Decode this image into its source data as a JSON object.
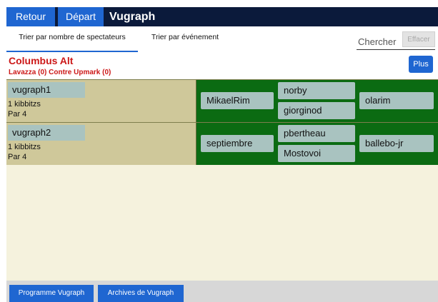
{
  "topbar": {
    "retour_label": "Retour",
    "depart_label": "Départ",
    "title": "Vugraph"
  },
  "tabs": [
    {
      "label": "Trier par nombre de spectateurs",
      "active": true
    },
    {
      "label": "Trier par événement",
      "active": false
    }
  ],
  "search": {
    "placeholder": "Chercher",
    "value": "",
    "clear_label": "Effacer"
  },
  "event": {
    "title": "Columbus Alt",
    "subtitle": "Lavazza (0) Contre Upmark (0)",
    "plus_label": "Plus"
  },
  "tables": [
    {
      "name": "vugraph1",
      "kibbitzers": "1 kibbitzs",
      "board": "Par 4",
      "west": "MikaelRim",
      "north": "norby",
      "south": "giorginod",
      "east": "olarim"
    },
    {
      "name": "vugraph2",
      "kibbitzers": "1 kibbitzs",
      "board": "Par 4",
      "west": "septiembre",
      "north": "pbertheau",
      "south": "Mostovoi",
      "east": "ballebo-jr"
    }
  ],
  "bottom": {
    "program_label": "Programme Vugraph",
    "archives_label": "Archives de Vugraph"
  },
  "colors": {
    "accent": "#1f66d1",
    "topbar": "#0b1a3b",
    "event_red": "#cc1818",
    "table_green": "#0b6b12",
    "table_tan": "#cfc89a",
    "player_chip": "#a9c3c0"
  }
}
